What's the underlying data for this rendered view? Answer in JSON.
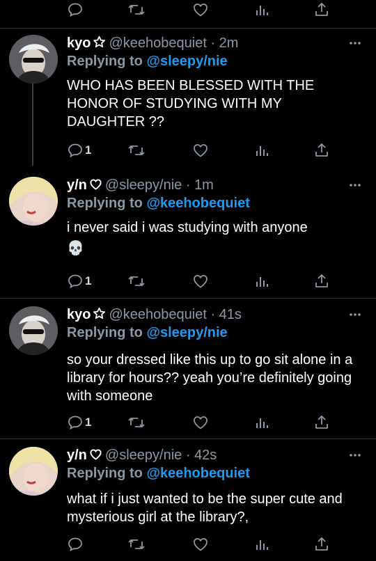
{
  "top_actions": {
    "reply_count": "",
    "retweet_count": "",
    "like_count": ""
  },
  "tweets": [
    {
      "author": "kyo",
      "badge_icon": "star-outline-icon",
      "handle": "@keehobequiet",
      "time": "2m",
      "replying_label": "Replying to",
      "replying_to": "@sleepy/nie",
      "text": "WHO HAS BEEN BLESSED WITH THE HONOR OF STUDYING WITH MY DAUGHTER ??",
      "reply_count": "1"
    },
    {
      "author": "y/n",
      "badge_icon": "heart-outline-icon",
      "handle": "@sleepy/nie",
      "time": "1m",
      "replying_label": "Replying to",
      "replying_to": "@keehobequiet",
      "text": "i never said i was studying with anyone",
      "text2": "💀",
      "reply_count": "1"
    },
    {
      "author": "kyo",
      "badge_icon": "star-outline-icon",
      "handle": "@keehobequiet",
      "time": "41s",
      "replying_label": "Replying to",
      "replying_to": "@sleepy/nie",
      "text": "so your dressed like this  up to go sit alone in a library for hours?? yeah you’re definitely going with someone",
      "reply_count": "1"
    },
    {
      "author": "y/n",
      "badge_icon": "heart-outline-icon",
      "handle": "@sleepy/nie",
      "time": "42s",
      "replying_label": "Replying to",
      "replying_to": "@keehobequiet",
      "text": "what if i just wanted to be the super cute and mysterious girl at the library?,",
      "reply_count": ""
    }
  ],
  "colors": {
    "background": "#000000",
    "text": "#e7e9ea",
    "muted": "#8b98a5",
    "accent": "#1d9bf0"
  }
}
